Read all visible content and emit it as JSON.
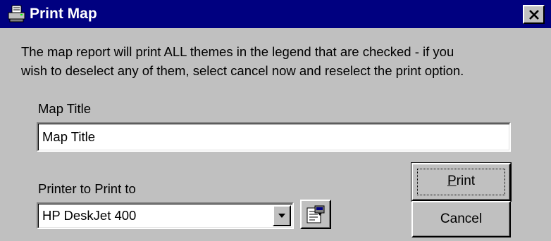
{
  "window": {
    "title": "Print Map",
    "close_glyph": "×",
    "icon": "printer-icon"
  },
  "message": {
    "line1": "The map report will print ALL themes in the legend that are checked - if you",
    "line2": "wish to deselect any of them, select cancel now and reselect the print option."
  },
  "map_title": {
    "label": "Map Title",
    "value": "Map Title"
  },
  "printer": {
    "label": "Printer to Print to",
    "selected": "HP DeskJet 400"
  },
  "buttons": {
    "print_mnemonic": "P",
    "print_rest": "rint",
    "cancel": "Cancel"
  },
  "colors": {
    "titlebar": "#000080",
    "face": "#c0c0c0"
  }
}
